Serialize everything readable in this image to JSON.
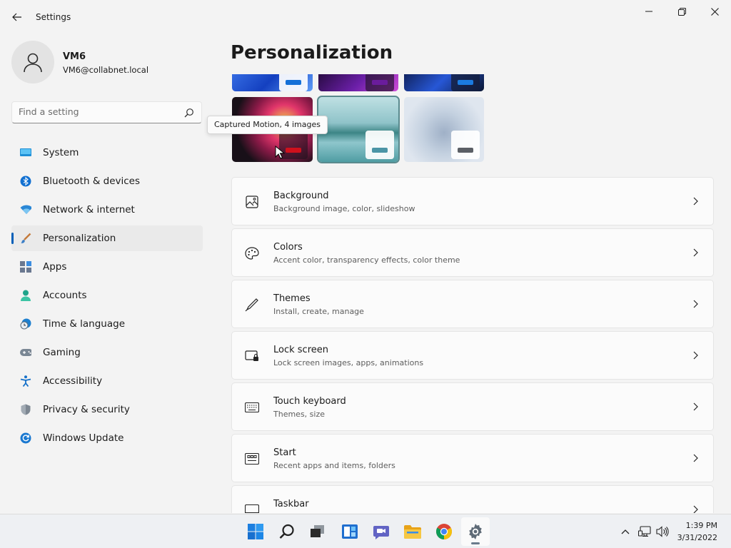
{
  "window": {
    "title": "Settings",
    "back_icon": "back-arrow-icon",
    "controls": [
      "minimize-icon",
      "restore-icon",
      "close-icon"
    ]
  },
  "user": {
    "name": "VM6",
    "email": "VM6@collabnet.local",
    "avatar_icon": "person-icon"
  },
  "search": {
    "placeholder": "Find a setting",
    "icon": "search-icon"
  },
  "nav": {
    "items": [
      {
        "label": "System",
        "icon": "monitor-icon"
      },
      {
        "label": "Bluetooth & devices",
        "icon": "bluetooth-icon"
      },
      {
        "label": "Network & internet",
        "icon": "wifi-icon"
      },
      {
        "label": "Personalization",
        "icon": "brush-icon",
        "selected": true
      },
      {
        "label": "Apps",
        "icon": "apps-icon"
      },
      {
        "label": "Accounts",
        "icon": "account-icon"
      },
      {
        "label": "Time & language",
        "icon": "clock-globe-icon"
      },
      {
        "label": "Gaming",
        "icon": "gamepad-icon"
      },
      {
        "label": "Accessibility",
        "icon": "accessibility-icon"
      },
      {
        "label": "Privacy & security",
        "icon": "shield-icon"
      },
      {
        "label": "Windows Update",
        "icon": "update-icon"
      }
    ]
  },
  "page": {
    "title": "Personalization"
  },
  "themes": {
    "tooltip": "Captured Motion, 4 images",
    "selected_index": 4
  },
  "cards": [
    {
      "title": "Background",
      "subtitle": "Background image, color, slideshow",
      "icon": "image-icon"
    },
    {
      "title": "Colors",
      "subtitle": "Accent color, transparency effects, color theme",
      "icon": "palette-icon"
    },
    {
      "title": "Themes",
      "subtitle": "Install, create, manage",
      "icon": "pen-icon"
    },
    {
      "title": "Lock screen",
      "subtitle": "Lock screen images, apps, animations",
      "icon": "lock-screen-icon"
    },
    {
      "title": "Touch keyboard",
      "subtitle": "Themes, size",
      "icon": "keyboard-icon"
    },
    {
      "title": "Start",
      "subtitle": "Recent apps and items, folders",
      "icon": "start-menu-icon"
    },
    {
      "title": "Taskbar",
      "subtitle": "",
      "icon": "taskbar-icon"
    }
  ],
  "taskbar": {
    "apps": [
      "windows-start-icon",
      "search-icon",
      "task-view-icon",
      "widgets-icon",
      "teams-chat-icon",
      "file-explorer-icon",
      "chrome-icon",
      "settings-gear-icon"
    ],
    "active_app": "settings-gear-icon",
    "tray": [
      "chevron-up-icon",
      "network-icon",
      "volume-icon"
    ],
    "time": "1:39 PM",
    "date": "3/31/2022"
  },
  "colors": {
    "accent": "#005fb8",
    "window_bg": "#f3f3f3",
    "card_bg": "#fbfbfb",
    "theme_selection_border": "#5a8a8e"
  }
}
